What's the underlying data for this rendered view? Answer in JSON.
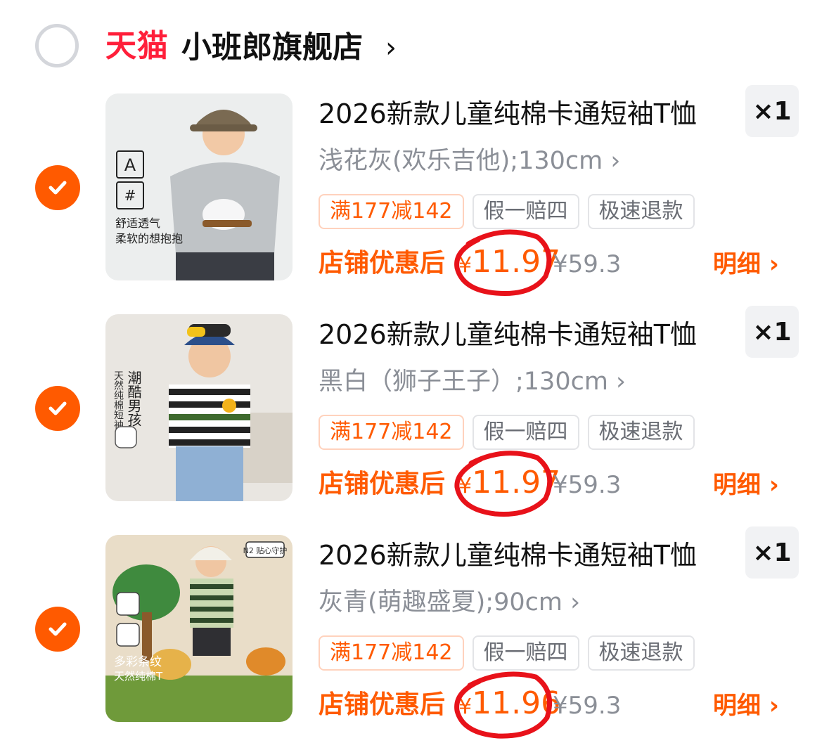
{
  "store": {
    "brand": "天猫",
    "name": "小班郎旗舰店",
    "chevron": "›"
  },
  "colors": {
    "accent": "#ff5a00",
    "brand_red": "#ff1f3a",
    "annotation_red": "#e8121a"
  },
  "items": [
    {
      "title": "2026新款儿童纯棉卡通短袖T恤",
      "quantity": "×1",
      "sku": "浅花灰(欢乐吉他);130cm ›",
      "tags": [
        "满177减142",
        "假一赔四",
        "极速退款"
      ],
      "price_label": "店铺优惠后",
      "currency": "¥",
      "price": "11.97",
      "original_price": "¥59.3",
      "detail": "明细 ›",
      "selected": true,
      "image_text": [
        "A",
        "舒适透气",
        "柔软的想抱抱"
      ]
    },
    {
      "title": "2026新款儿童纯棉卡通短袖T恤",
      "quantity": "×1",
      "sku": "黑白（狮子王子）;130cm ›",
      "tags": [
        "满177减142",
        "假一赔四",
        "极速退款"
      ],
      "price_label": "店铺优惠后",
      "currency": "¥",
      "price": "11.97",
      "original_price": "¥59.3",
      "detail": "明细 ›",
      "selected": true,
      "image_text": [
        "潮酷男孩",
        "天然纯棉短袖"
      ]
    },
    {
      "title": "2026新款儿童纯棉卡通短袖T恤",
      "quantity": "×1",
      "sku": "灰青(萌趣盛夏);90cm ›",
      "tags": [
        "满177减142",
        "假一赔四",
        "极速退款"
      ],
      "price_label": "店铺优惠后",
      "currency": "¥",
      "price": "11.96",
      "original_price": "¥59.3",
      "detail": "明细 ›",
      "selected": true,
      "image_text": [
        "N2 贴心守护",
        "多彩条纹",
        "天然纯棉T"
      ]
    }
  ]
}
